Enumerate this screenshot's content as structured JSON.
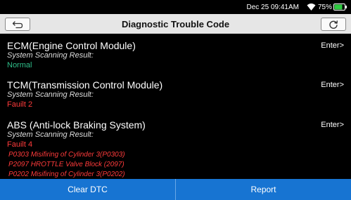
{
  "status_bar": {
    "time": "Dec 25 09:41AM",
    "battery": "75%",
    "battery_level": 0.75
  },
  "header": {
    "title": "Diagnostic Trouble Code",
    "back_icon": "back-arrow-icon",
    "refresh_icon": "refresh-icon"
  },
  "modules": [
    {
      "name": "ECM(Engine Control Module)",
      "sub": "System Scanning Result:",
      "result": "Normal",
      "enter": "Enter>"
    },
    {
      "name": "TCM(Transmission Control Module)",
      "sub": "System Scanning Result:",
      "result": "Fauilt 2",
      "enter": "Enter>"
    },
    {
      "name": "ABS (Anti-lock Braking System)",
      "sub": "System Scanning Result:",
      "result": "Fauilt 4",
      "enter": "Enter>",
      "codes": [
        "P0303 Misifiring of Cylinder 3(P0303)",
        "P2097 HROTTLE Valve Block (2097)",
        "P0202 Misifiring of Cylinder 3(P0202)"
      ]
    }
  ],
  "footer": {
    "clear_label": "Clear DTC",
    "report_label": "Report"
  },
  "colors": {
    "normal": "#2fbf8a",
    "fault": "#ff3b3b",
    "footer": "#1774d2"
  }
}
